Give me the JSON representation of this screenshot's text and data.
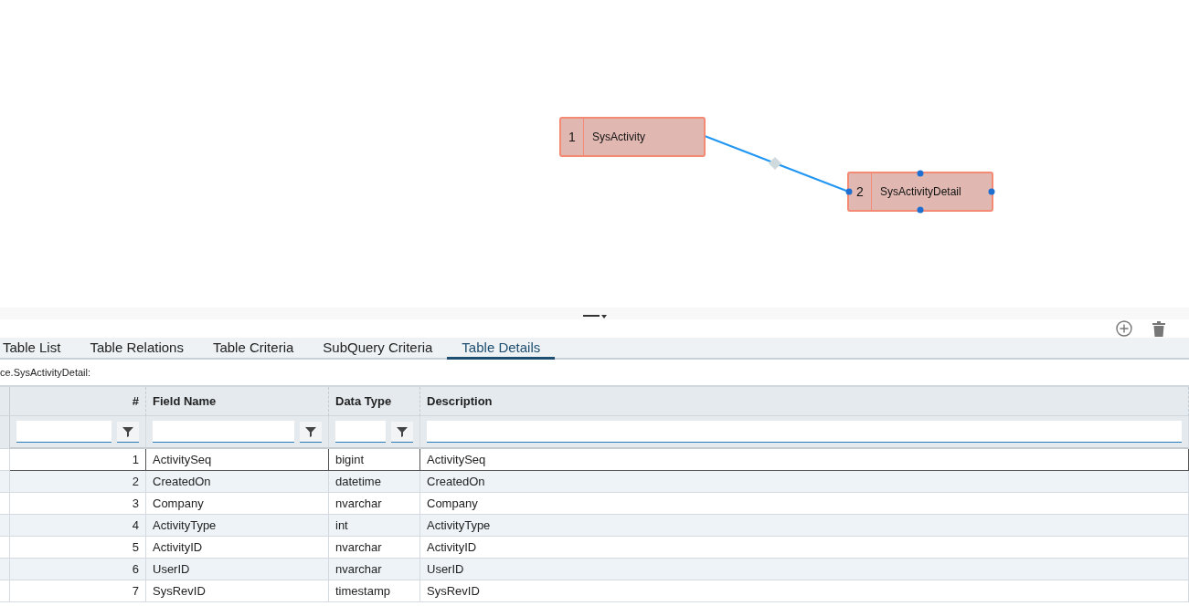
{
  "diagram": {
    "nodes": [
      {
        "number": "1",
        "name": "SysActivity",
        "selected": false
      },
      {
        "number": "2",
        "name": "SysActivityDetail",
        "selected": true
      }
    ]
  },
  "tabs": [
    {
      "label": "Table List",
      "selected": false
    },
    {
      "label": "Table Relations",
      "selected": false
    },
    {
      "label": "Table Criteria",
      "selected": false
    },
    {
      "label": "SubQuery Criteria",
      "selected": false
    },
    {
      "label": "Table Details",
      "selected": true
    }
  ],
  "table_path": "ce.SysActivityDetail:",
  "table": {
    "columns": [
      "#",
      "Field Name",
      "Data Type",
      "Description"
    ],
    "rows": [
      {
        "cells": [
          "1",
          "ActivitySeq",
          "bigint",
          "ActivitySeq"
        ],
        "selected": true
      },
      {
        "cells": [
          "2",
          "CreatedOn",
          "datetime",
          "CreatedOn"
        ],
        "selected": false
      },
      {
        "cells": [
          "3",
          "Company",
          "nvarchar",
          "Company"
        ],
        "selected": false
      },
      {
        "cells": [
          "4",
          "ActivityType",
          "int",
          "ActivityType"
        ],
        "selected": false
      },
      {
        "cells": [
          "5",
          "ActivityID",
          "nvarchar",
          "ActivityID"
        ],
        "selected": false
      },
      {
        "cells": [
          "6",
          "UserID",
          "nvarchar",
          "UserID"
        ],
        "selected": false
      },
      {
        "cells": [
          "7",
          "SysRevID",
          "timestamp",
          "SysRevID"
        ],
        "selected": false
      }
    ]
  }
}
